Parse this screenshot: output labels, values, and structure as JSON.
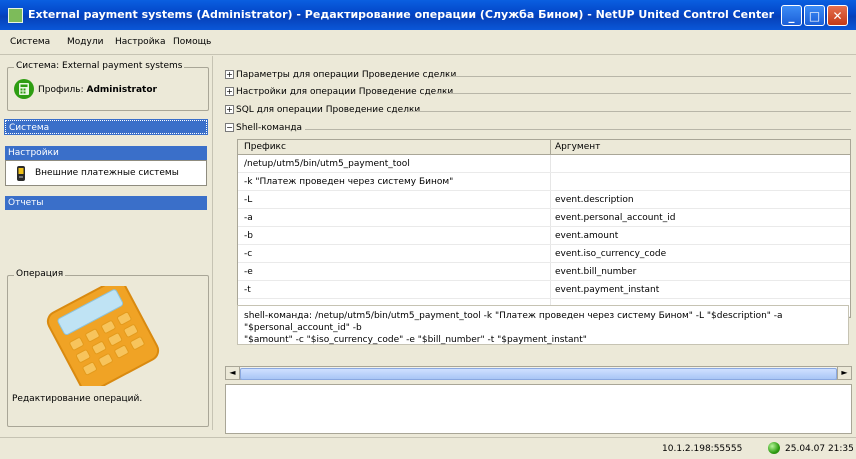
{
  "window": {
    "title": "External payment systems (Administrator) - Редактирование операции (Служба Бином) - NetUP United Control Center",
    "minimize_glyph": "_",
    "maximize_glyph": "□",
    "close_glyph": "✕"
  },
  "menu": [
    "Система",
    "Модули",
    "Настройка",
    "Помощь"
  ],
  "sidebar": {
    "system_legend": "Система: External payment systems",
    "profile_label": "Профиль:",
    "profile_value": "Administrator",
    "nav_system": "Система",
    "nav_settings": "Настройки",
    "nav_item_external": "Внешние платежные системы",
    "nav_reports": "Отчеты",
    "operation_legend": "Операция",
    "operation_desc": "Редактирование операций."
  },
  "sections": [
    "Параметры для операции Проведение сделки",
    "Настройки для операции Проведение сделки",
    "SQL для операции Проведение сделки",
    "Shell-команда"
  ],
  "table": {
    "col_prefix": "Префикс",
    "col_argument": "Аргумент",
    "rows": [
      {
        "prefix": "/netup/utm5/bin/utm5_payment_tool",
        "argument": ""
      },
      {
        "prefix": "-k \"Платеж проведен через систему Бином\"",
        "argument": ""
      },
      {
        "prefix": "-L",
        "argument": "event.description"
      },
      {
        "prefix": "-a",
        "argument": "event.personal_account_id"
      },
      {
        "prefix": "-b",
        "argument": "event.amount"
      },
      {
        "prefix": "-c",
        "argument": "event.iso_currency_code"
      },
      {
        "prefix": "-e",
        "argument": "event.bill_number"
      },
      {
        "prefix": "-t",
        "argument": "event.payment_instant"
      },
      {
        "prefix": "",
        "argument": ""
      }
    ]
  },
  "shell_command_line1": "shell-команда: /netup/utm5/bin/utm5_payment_tool -k \"Платеж проведен через систему Бином\" -L \"$description\" -a \"$personal_account_id\" -b",
  "shell_command_line2": "\"$amount\" -c \"$iso_currency_code\" -e \"$bill_number\" -t \"$payment_instant\"",
  "scroll": {
    "left": "◄",
    "right": "►"
  },
  "status": {
    "address": "10.1.2.198:55555",
    "datetime": "25.04.07 21:35"
  }
}
